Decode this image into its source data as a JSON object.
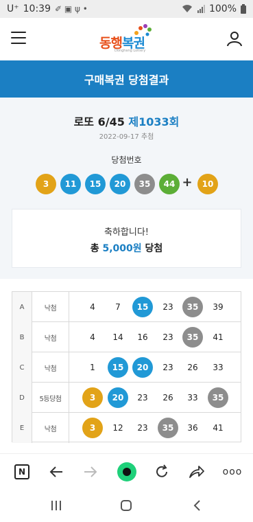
{
  "status_bar": {
    "carrier": "U⁺",
    "time": "10:39",
    "icons_left": "✐ ▣ ψ •",
    "battery": "100%"
  },
  "header": {
    "logo_text_1": "동행",
    "logo_text_2": "복권",
    "logo_sub": "Donghang Lottery"
  },
  "title_bar": {
    "title": "구매복권 당첨결과"
  },
  "draw": {
    "name": "로또 6/45",
    "round": "제1033회",
    "date": "2022-09-17 추첨",
    "numbers_label": "당첨번호",
    "numbers": [
      "3",
      "11",
      "15",
      "20",
      "35",
      "44"
    ],
    "bonus_sign": "+",
    "bonus": "10"
  },
  "congrats": {
    "message": "축하합니다!",
    "prefix": "총",
    "amount": "5,000원",
    "suffix": "당첨"
  },
  "ticket": {
    "rows": [
      {
        "game": "A",
        "result": "낙첨",
        "numbers": [
          "4",
          "7",
          "15",
          "23",
          "35",
          "39"
        ]
      },
      {
        "game": "B",
        "result": "낙첨",
        "numbers": [
          "4",
          "14",
          "16",
          "23",
          "35",
          "41"
        ]
      },
      {
        "game": "C",
        "result": "낙첨",
        "numbers": [
          "1",
          "15",
          "20",
          "23",
          "26",
          "33"
        ]
      },
      {
        "game": "D",
        "result": "5등당첨",
        "numbers": [
          "3",
          "20",
          "23",
          "26",
          "33",
          "35"
        ]
      },
      {
        "game": "E",
        "result": "낙첨",
        "numbers": [
          "3",
          "12",
          "23",
          "35",
          "36",
          "41"
        ]
      }
    ]
  },
  "browser_toolbar": {
    "n_label": "N",
    "more": "ooo"
  },
  "colors": {
    "brand_blue": "#1b7fc3",
    "yellow": "#e2a318",
    "blue": "#2199d6",
    "grey": "#8d8d8d",
    "green": "#5cae37",
    "home_green": "#1fd07a"
  }
}
